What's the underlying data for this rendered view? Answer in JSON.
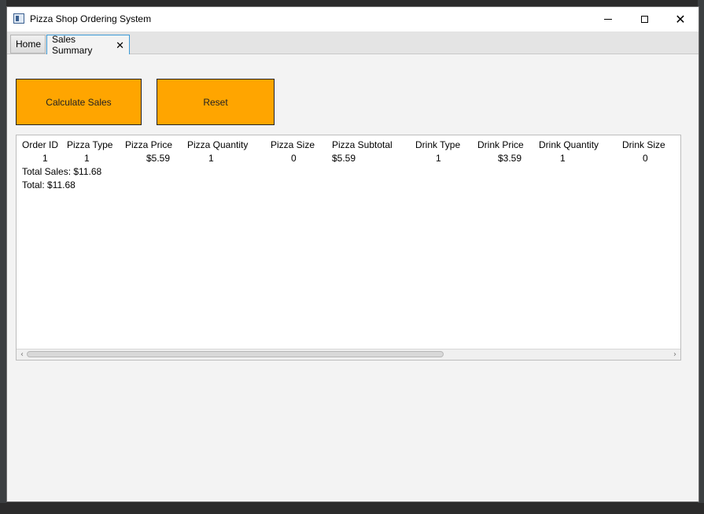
{
  "window": {
    "title": "Pizza Shop Ordering System"
  },
  "tabs": [
    {
      "label": "Home"
    },
    {
      "label": "Sales Summary",
      "close_glyph": "✕"
    }
  ],
  "buttons": {
    "calculate_label": "Calculate Sales",
    "reset_label": "Reset"
  },
  "summary": {
    "columns": [
      "Order ID",
      "Pizza Type",
      "Pizza Price",
      "Pizza Quantity",
      "Pizza Size",
      "Pizza Subtotal",
      "Drink Type",
      "Drink Price",
      "Drink Quantity",
      "Drink Size"
    ],
    "rows": [
      [
        "1",
        "1",
        "$5.59",
        "1",
        "0",
        "$5.59",
        "1",
        "$3.59",
        "1",
        "0"
      ]
    ],
    "total_sales": "Total Sales: $11.68",
    "total": "Total: $11.68"
  },
  "colors": {
    "button_bg": "#ffa500",
    "tab_accent": "#3c9ad6"
  },
  "icons": {
    "app": "app-window-icon",
    "minimize": "minimize-icon",
    "maximize": "maximize-icon",
    "close": "close-icon",
    "tab_close": "close-icon"
  }
}
